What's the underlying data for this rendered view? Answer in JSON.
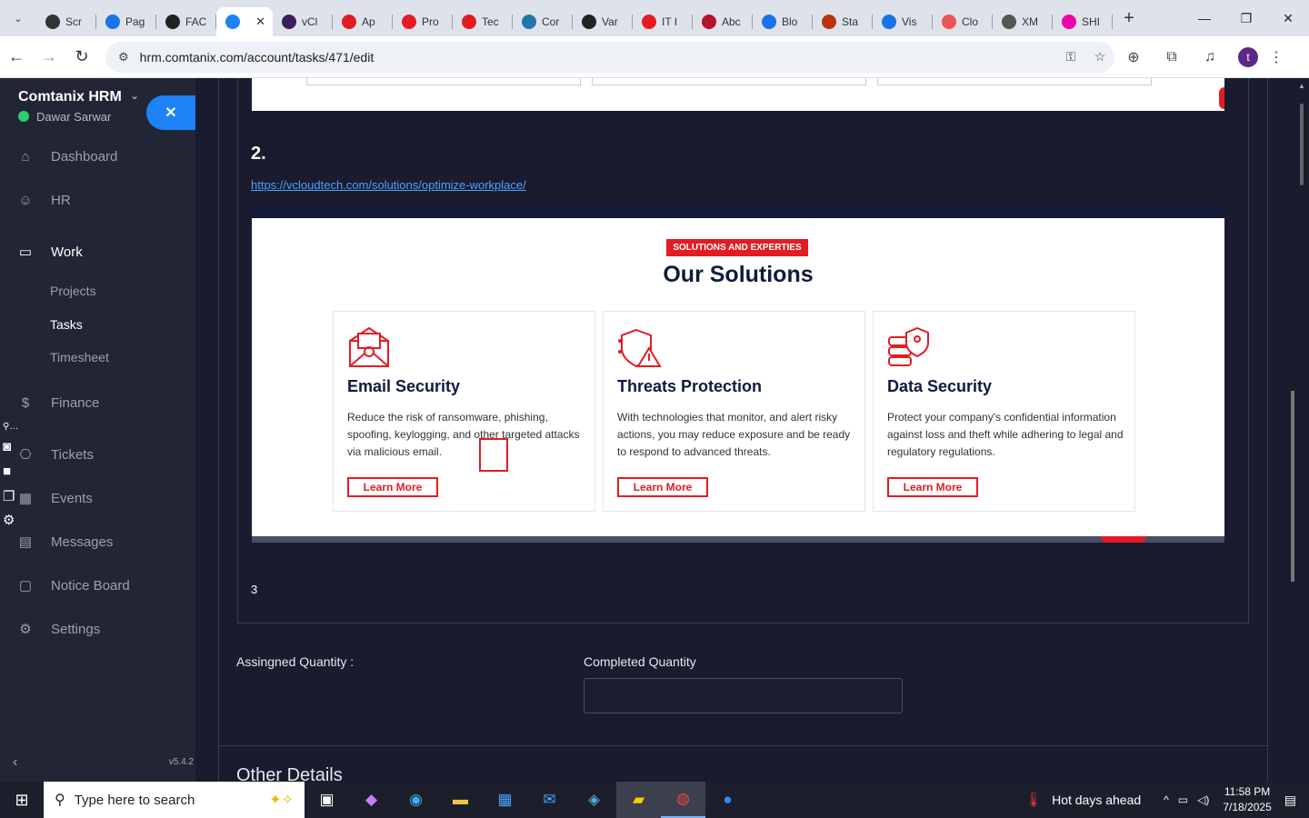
{
  "browser": {
    "tabs": [
      {
        "label": "Scr",
        "color": "#333"
      },
      {
        "label": "Pag",
        "color": "#1a73e8"
      },
      {
        "label": "FAC",
        "color": "#222"
      },
      {
        "label": "",
        "color": "#1d82f5",
        "active": true
      },
      {
        "label": "vCl",
        "color": "#3b1f5a"
      },
      {
        "label": "Ap",
        "color": "#e31c24"
      },
      {
        "label": "Pro",
        "color": "#e31c24"
      },
      {
        "label": "Tec",
        "color": "#e31c24"
      },
      {
        "label": "Cor",
        "color": "#27a"
      },
      {
        "label": "Var",
        "color": "#222"
      },
      {
        "label": "IT I",
        "color": "#e31c24"
      },
      {
        "label": "Abc",
        "color": "#b3132b"
      },
      {
        "label": "Blo",
        "color": "#1a73e8"
      },
      {
        "label": "Sta",
        "color": "#b31"
      },
      {
        "label": "Vis",
        "color": "#1a73e8"
      },
      {
        "label": "Clo",
        "color": "#e55"
      },
      {
        "label": "XM",
        "color": "#555"
      },
      {
        "label": "SHI",
        "color": "#e0a"
      }
    ],
    "url": "hrm.comtanix.com/account/tasks/471/edit",
    "profile_initial": "t"
  },
  "sidebar": {
    "brand": "Comtanix HRM",
    "user": "Dawar Sarwar",
    "menu": [
      {
        "label": "Dashboard",
        "icon": "home-icon"
      },
      {
        "label": "HR",
        "icon": "users-icon"
      },
      {
        "label": "Work",
        "icon": "briefcase-icon"
      },
      {
        "label": "Finance",
        "icon": "dollar-icon"
      },
      {
        "label": "Tickets",
        "icon": "ticket-icon"
      },
      {
        "label": "Events",
        "icon": "calendar-icon"
      },
      {
        "label": "Messages",
        "icon": "chat-icon"
      },
      {
        "label": "Notice Board",
        "icon": "clipboard-icon"
      },
      {
        "label": "Settings",
        "icon": "gear-icon"
      }
    ],
    "work_sub": [
      "Projects",
      "Tasks",
      "Timesheet"
    ],
    "version": "v5.4.2"
  },
  "content": {
    "section_number": "2.",
    "link": "https://vcloudtech.com/solutions/optimize-workplace/",
    "screenshot": {
      "badge": "SOLUTIONS AND EXPERTIES",
      "title": "Our Solutions",
      "cards": [
        {
          "title": "Email Security",
          "desc": "Reduce the risk of ransomware, phishing, spoofing, keylogging, and other targeted attacks via malicious email.",
          "cta": "Learn More"
        },
        {
          "title": "Threats Protection",
          "desc": "With technologies that monitor, and alert risky actions, you may reduce exposure and be ready to respond to advanced threats.",
          "cta": "Learn More"
        },
        {
          "title": "Data Security",
          "desc": "Protect your company's confidential information against loss and theft while adhering to legal and regulatory regulations.",
          "cta": "Learn More"
        }
      ]
    },
    "item_three": "3",
    "assigned_label": "Assingned Quantity :",
    "completed_label": "Completed Quantity",
    "completed_value": "",
    "other_heading": "Other Details"
  },
  "taskbar": {
    "search_placeholder": "Type here to search",
    "weather": "Hot days ahead",
    "time": "11:58 PM",
    "date": "7/18/2025"
  }
}
